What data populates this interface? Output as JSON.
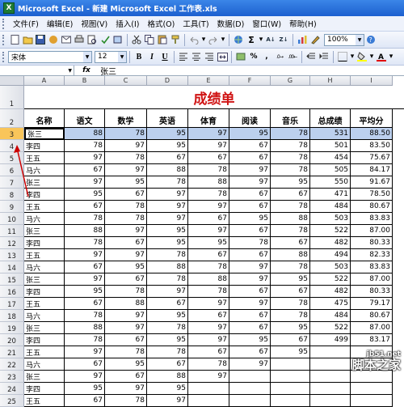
{
  "window": {
    "title": "Microsoft Excel - 新建 Microsoft Excel 工作表.xls"
  },
  "menu": [
    "文件(F)",
    "编辑(E)",
    "视图(V)",
    "插入(I)",
    "格式(O)",
    "工具(T)",
    "数据(D)",
    "窗口(W)",
    "帮助(H)"
  ],
  "toolbar": {
    "zoom": "100%",
    "font": "宋体",
    "size": "12",
    "bold": "B",
    "italic": "I",
    "underline": "U",
    "percent": "%",
    "comma": ","
  },
  "formula": {
    "namebox": "A3",
    "fx": "fx",
    "value": "张三"
  },
  "columns": [
    "A",
    "B",
    "C",
    "D",
    "E",
    "F",
    "G",
    "H",
    "I"
  ],
  "sheet_title": "成绩单",
  "headers": [
    "名称",
    "语文",
    "数学",
    "英语",
    "体育",
    "阅读",
    "音乐",
    "总成绩",
    "平均分"
  ],
  "rows": [
    {
      "n": "3",
      "v": [
        "张三",
        "88",
        "78",
        "95",
        "97",
        "95",
        "78",
        "531",
        "88.50"
      ]
    },
    {
      "n": "4",
      "v": [
        "李四",
        "78",
        "97",
        "95",
        "97",
        "67",
        "78",
        "501",
        "83.50"
      ]
    },
    {
      "n": "5",
      "v": [
        "王五",
        "97",
        "78",
        "67",
        "67",
        "67",
        "78",
        "454",
        "75.67"
      ]
    },
    {
      "n": "6",
      "v": [
        "马六",
        "67",
        "97",
        "88",
        "78",
        "97",
        "78",
        "505",
        "84.17"
      ]
    },
    {
      "n": "7",
      "v": [
        "张三",
        "97",
        "95",
        "78",
        "88",
        "97",
        "95",
        "550",
        "91.67"
      ]
    },
    {
      "n": "8",
      "v": [
        "李四",
        "95",
        "67",
        "97",
        "78",
        "67",
        "67",
        "471",
        "78.50"
      ]
    },
    {
      "n": "9",
      "v": [
        "王五",
        "67",
        "78",
        "97",
        "97",
        "67",
        "78",
        "484",
        "80.67"
      ]
    },
    {
      "n": "10",
      "v": [
        "马六",
        "78",
        "78",
        "97",
        "67",
        "95",
        "88",
        "503",
        "83.83"
      ]
    },
    {
      "n": "11",
      "v": [
        "张三",
        "88",
        "97",
        "95",
        "97",
        "67",
        "78",
        "522",
        "87.00"
      ]
    },
    {
      "n": "12",
      "v": [
        "李四",
        "78",
        "67",
        "95",
        "95",
        "78",
        "67",
        "482",
        "80.33"
      ]
    },
    {
      "n": "13",
      "v": [
        "王五",
        "97",
        "97",
        "78",
        "67",
        "67",
        "88",
        "494",
        "82.33"
      ]
    },
    {
      "n": "14",
      "v": [
        "马六",
        "67",
        "95",
        "88",
        "78",
        "97",
        "78",
        "503",
        "83.83"
      ]
    },
    {
      "n": "15",
      "v": [
        "张三",
        "97",
        "67",
        "78",
        "88",
        "97",
        "95",
        "522",
        "87.00"
      ]
    },
    {
      "n": "16",
      "v": [
        "李四",
        "95",
        "78",
        "97",
        "78",
        "67",
        "67",
        "482",
        "80.33"
      ]
    },
    {
      "n": "17",
      "v": [
        "王五",
        "67",
        "88",
        "67",
        "97",
        "97",
        "78",
        "475",
        "79.17"
      ]
    },
    {
      "n": "18",
      "v": [
        "马六",
        "78",
        "97",
        "95",
        "67",
        "67",
        "78",
        "484",
        "80.67"
      ]
    },
    {
      "n": "19",
      "v": [
        "张三",
        "88",
        "97",
        "78",
        "97",
        "67",
        "95",
        "522",
        "87.00"
      ]
    },
    {
      "n": "20",
      "v": [
        "李四",
        "78",
        "67",
        "95",
        "97",
        "95",
        "67",
        "499",
        "83.17"
      ]
    },
    {
      "n": "21",
      "v": [
        "王五",
        "97",
        "78",
        "78",
        "67",
        "67",
        "95",
        "",
        "",
        ""
      ]
    },
    {
      "n": "22",
      "v": [
        "马六",
        "67",
        "95",
        "67",
        "78",
        "97",
        "",
        "",
        "",
        ""
      ]
    },
    {
      "n": "23",
      "v": [
        "张三",
        "97",
        "67",
        "88",
        "97",
        "",
        "",
        "",
        "",
        ""
      ]
    },
    {
      "n": "24",
      "v": [
        "李四",
        "95",
        "97",
        "95",
        "",
        "",
        "",
        "",
        "",
        ""
      ]
    },
    {
      "n": "25",
      "v": [
        "王五",
        "67",
        "78",
        "97",
        "",
        "",
        "",
        "",
        "",
        ""
      ]
    }
  ],
  "watermark": {
    "line1": "jb51.net",
    "line2": "脚本之家"
  }
}
